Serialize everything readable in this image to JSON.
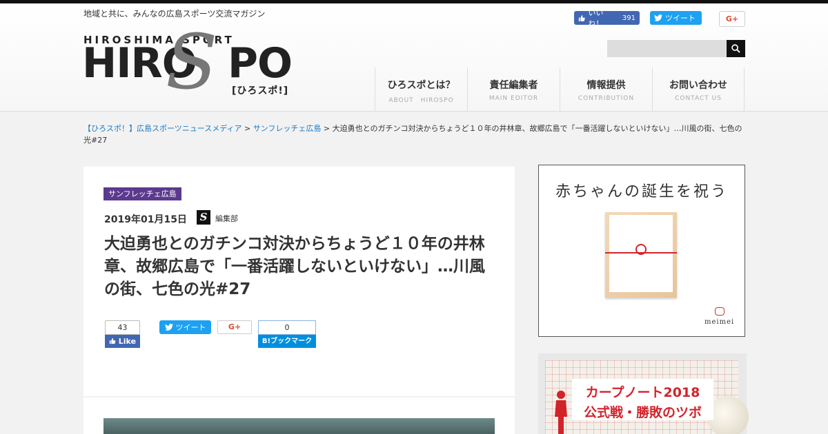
{
  "site": {
    "tagline": "地域と共に、みんなの広島スポーツ交流マガジン",
    "logo_small": "HIROSHIMA SPORT",
    "logo_main_left": "HIRO",
    "logo_main_s": "S",
    "logo_main_right": "PO",
    "logo_sub": "[ひろスポ!]"
  },
  "header_social": {
    "fb_like_label": "いいね！",
    "fb_like_count": "391",
    "tweet_label": "ツイート",
    "gplus_label": "G+"
  },
  "search": {
    "placeholder": ""
  },
  "nav": {
    "items": [
      {
        "label": "ひろスポとは？",
        "sub": "ABOUT　HIROSPO"
      },
      {
        "label": "責任編集者",
        "sub": "MAIN EDITOR"
      },
      {
        "label": "情報提供",
        "sub": "CONTRIBUTION"
      },
      {
        "label": "お問い合わせ",
        "sub": "CONTACT US"
      }
    ]
  },
  "breadcrumb": {
    "home": "【ひろスポ！】広島スポーツニュースメディア",
    "sep1": " > ",
    "category": "サンフレッチェ広島",
    "sep2": " > ",
    "current": "大迫勇也とのガチンコ対決からちょうど１０年の井林章、故郷広島で「一番活躍しないといけない」…川風の街、七色の光#27"
  },
  "article": {
    "category": "サンフレッチェ広島",
    "date": "2019年01月15日",
    "author_logo": "S",
    "author": "編集部",
    "title": "大迫勇也とのガチンコ対決からちょうど１０年の井林章、故郷広島で「一番活躍しないといけない」…川風の街、七色の光#27"
  },
  "share": {
    "fb_count": "43",
    "fb_label": "Like",
    "tweet_label": "ツイート",
    "gplus_label": "G+",
    "hatena_count": "0",
    "hatena_label": "B!ブックマーク"
  },
  "ads": {
    "ad1_title": "赤ちゃんの誕生を祝う",
    "ad1_brand": "meimei",
    "ad2_line1": "カープノート2018",
    "ad2_line2": "公式戦・勝敗のツボ"
  }
}
